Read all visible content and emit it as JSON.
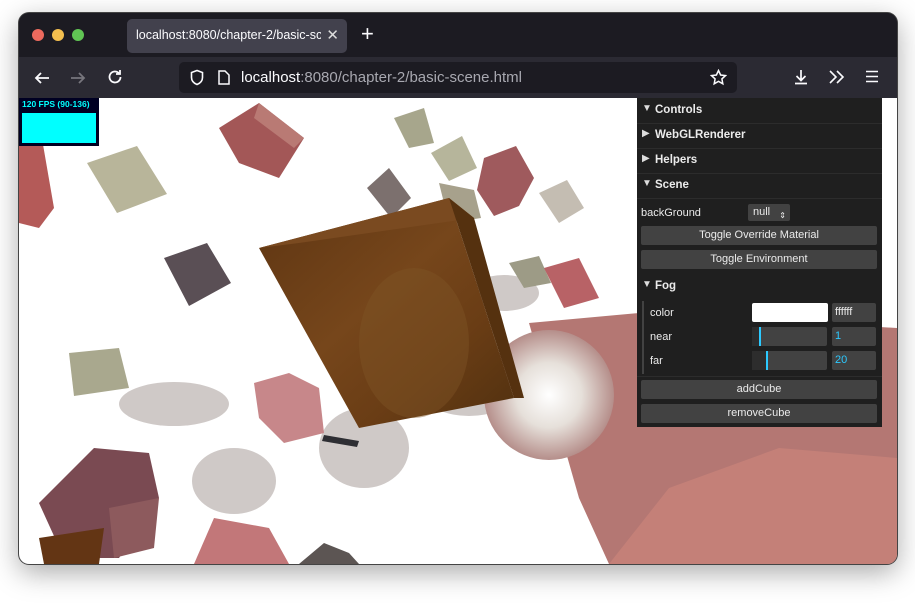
{
  "browser": {
    "tab_title": "localhost:8080/chapter-2/basic-sce",
    "tab_close_glyph": "✕",
    "new_tab_glyph": "+",
    "url_host": "localhost",
    "url_rest": ":8080/chapter-2/basic-scene.html",
    "icons": [
      "back-arrow-icon",
      "forward-arrow-icon",
      "reload-icon",
      "shield-icon",
      "page-icon",
      "bookmark-star-icon",
      "download-icon",
      "extensions-overflow-icon",
      "menu-icon"
    ]
  },
  "stats": {
    "label": "120 FPS (90-136)"
  },
  "gui": {
    "folders": {
      "controls": "Controls",
      "webglrenderer": "WebGLRenderer",
      "helpers": "Helpers",
      "scene": "Scene",
      "fog": "Fog"
    },
    "background_label": "backGround",
    "background_value": "null",
    "toggle_override": "Toggle Override Material",
    "toggle_environment": "Toggle Environment",
    "fog": {
      "color_label": "color",
      "color_value": "ffffff",
      "near_label": "near",
      "near_value": "1",
      "far_label": "far",
      "far_value": "20"
    },
    "add_cube": "addCube",
    "remove_cube": "removeCube",
    "accent_color": "#2cc9ff"
  }
}
